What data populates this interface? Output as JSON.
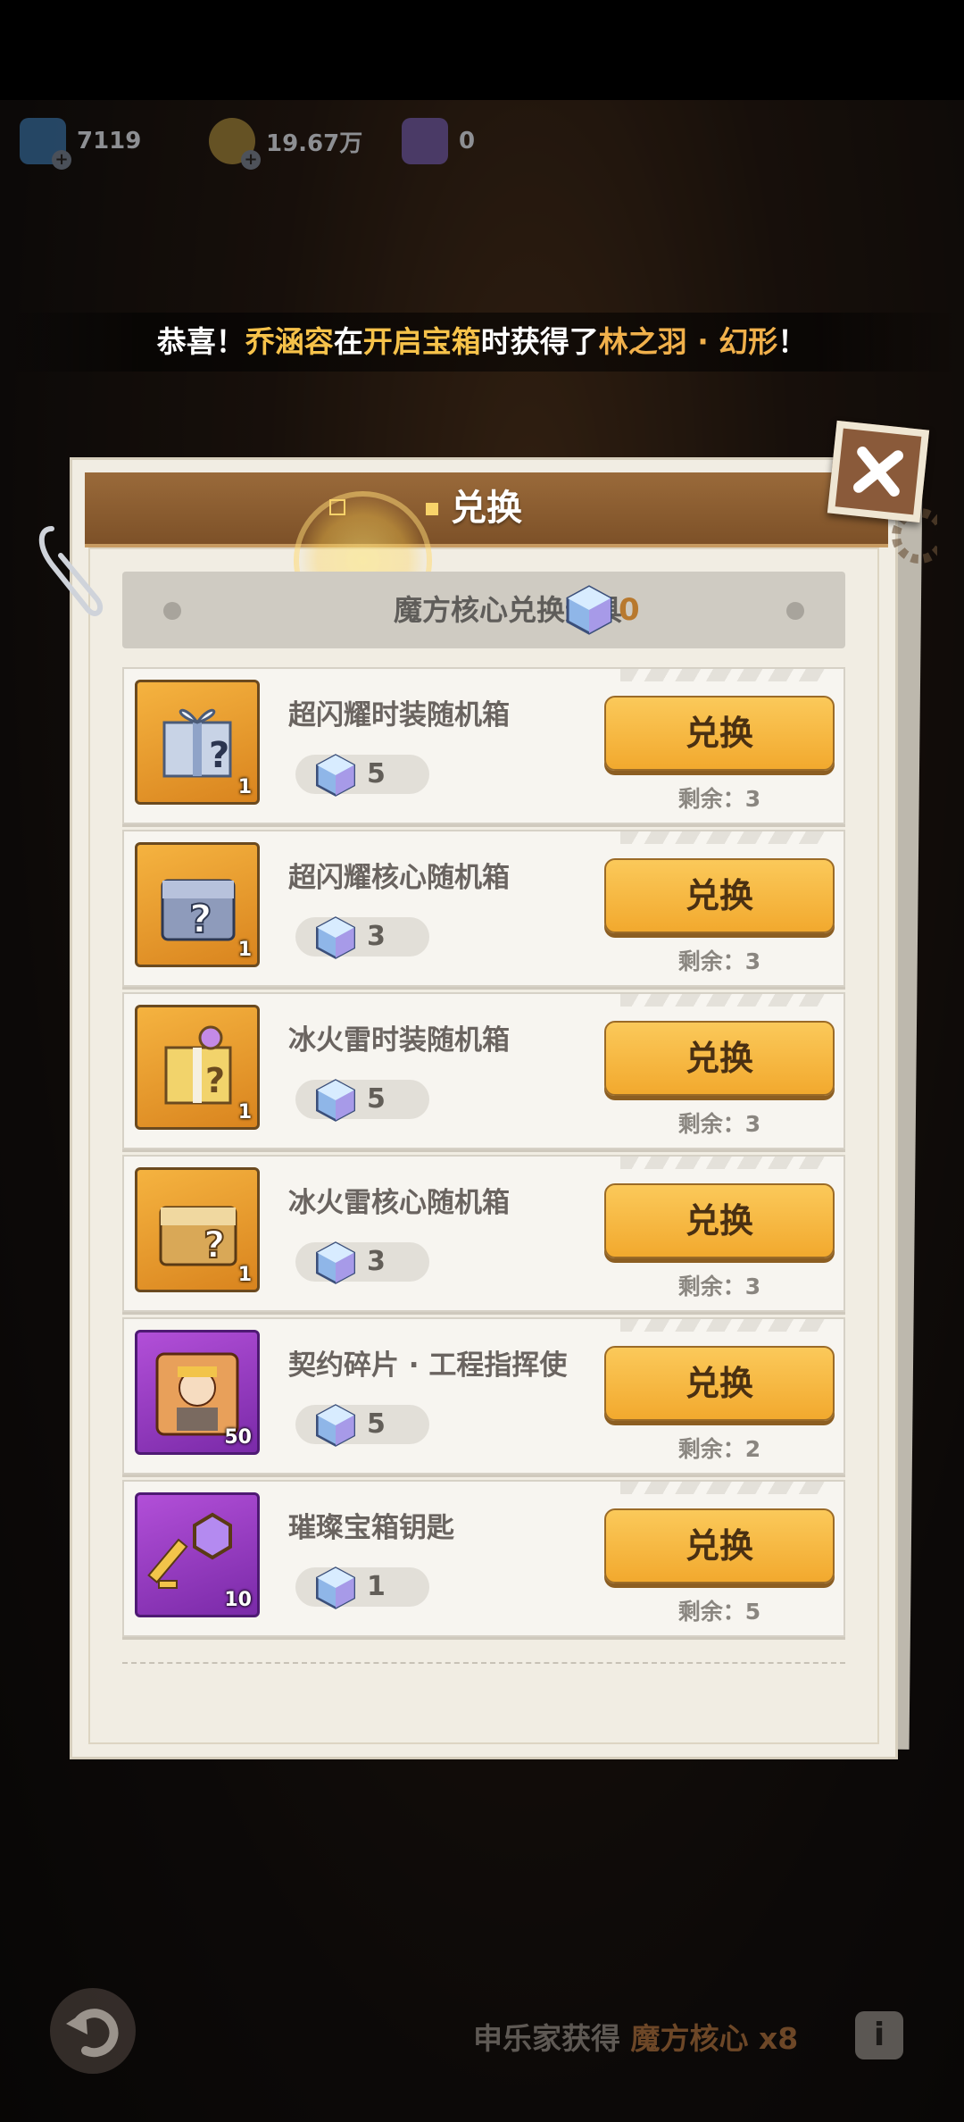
{
  "currencies": [
    {
      "icon": "card-icon",
      "value": "7119"
    },
    {
      "icon": "coin-icon",
      "value": "19.67万"
    },
    {
      "icon": "ticket-icon",
      "value": "0"
    }
  ],
  "broadcast": {
    "prefix": "恭喜！",
    "player": "乔涵容",
    "mid": "在",
    "action": "开启宝箱",
    "mid2": "时获得了",
    "reward": "林之羽 · 幻形",
    "suffix": "！"
  },
  "dialog": {
    "title": "兑换",
    "header_label": "魔方核心兑换道具",
    "header_count": "0"
  },
  "items": [
    {
      "name": "超闪耀时装随机箱",
      "qty": "1",
      "cost": "5",
      "button": "兑换",
      "remaining": "剩余：3",
      "icon": "silver-gift-box-icon",
      "frame": "gold"
    },
    {
      "name": "超闪耀核心随机箱",
      "qty": "1",
      "cost": "3",
      "button": "兑换",
      "remaining": "剩余：3",
      "icon": "silver-mystery-chest-icon",
      "frame": "gold"
    },
    {
      "name": "冰火雷时装随机箱",
      "qty": "1",
      "cost": "5",
      "button": "兑换",
      "remaining": "剩余：3",
      "icon": "gold-gift-box-icon",
      "frame": "gold"
    },
    {
      "name": "冰火雷核心随机箱",
      "qty": "1",
      "cost": "3",
      "button": "兑换",
      "remaining": "剩余：3",
      "icon": "gold-mystery-chest-icon",
      "frame": "gold"
    },
    {
      "name": "契约碎片 · 工程指挥使",
      "qty": "50",
      "cost": "5",
      "button": "兑换",
      "remaining": "剩余：2",
      "icon": "puzzle-portrait-icon",
      "frame": "purple"
    },
    {
      "name": "璀璨宝箱钥匙",
      "qty": "10",
      "cost": "1",
      "button": "兑换",
      "remaining": "剩余：5",
      "icon": "purple-key-icon",
      "frame": "purple"
    }
  ],
  "bottom": {
    "text": "申乐家获得",
    "item": "魔方核心 x8"
  },
  "colors": {
    "accent": "#f2a92e",
    "title_bar": "#8a5a30",
    "highlight": "#f6c24a"
  }
}
